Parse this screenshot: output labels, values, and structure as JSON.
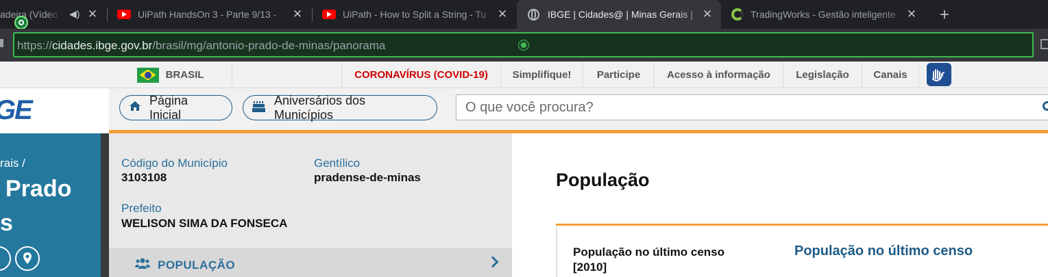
{
  "browser": {
    "tabs": [
      {
        "title": "adeira (Vídeo",
        "icon": "speaker-icon",
        "active": false
      },
      {
        "title": "UiPath HandsOn 3 - Parte 9/13 - ",
        "icon": "youtube-icon",
        "active": false
      },
      {
        "title": "UiPath - How to Split a String - Tu",
        "icon": "youtube-icon",
        "active": false
      },
      {
        "title": "IBGE | Cidades@ | Minas Gerais | ",
        "icon": "globe-icon",
        "active": true
      },
      {
        "title": "TradingWorks - Gestão inteligente",
        "icon": "tradingworks-icon",
        "active": false
      }
    ],
    "close_glyph": "✕",
    "new_tab_glyph": "+",
    "url_scheme": "https://",
    "url_host": "cidades.ibge.gov.br",
    "url_path": "/brasil/mg/antonio-prado-de-minas/panorama",
    "accent": "#3fb950"
  },
  "govbar": {
    "brasil": "BRASIL",
    "covid": "CORONAVÍRUS (COVID-19)",
    "links": [
      "Simplifique!",
      "Participe",
      "Acesso à informação",
      "Legislação",
      "Canais"
    ],
    "covid_color": "#cc0000"
  },
  "header": {
    "logo": "GE",
    "home": "Página Inicial",
    "anniversaries": "Aniversários dos Municípios",
    "search_placeholder": "O que você procura?"
  },
  "sidebar": {
    "breadcrumb": "rais /",
    "city_line1": "Prado",
    "city_line2": "s",
    "color": "#24789e"
  },
  "info": {
    "codigo_label": "Código do Município",
    "codigo_value": "3103108",
    "gentilico_label": "Gentílico",
    "gentilico_value": "pradense-de-minas",
    "prefeito_label": "Prefeito",
    "prefeito_value": "WELISON SIMA DA FONSECA"
  },
  "menu": {
    "populacao": "POPULAÇÃO"
  },
  "main": {
    "title": "População",
    "card_label": "População no último censo [2010]",
    "card_heading": "População no último censo",
    "accent": "#f39c35"
  }
}
